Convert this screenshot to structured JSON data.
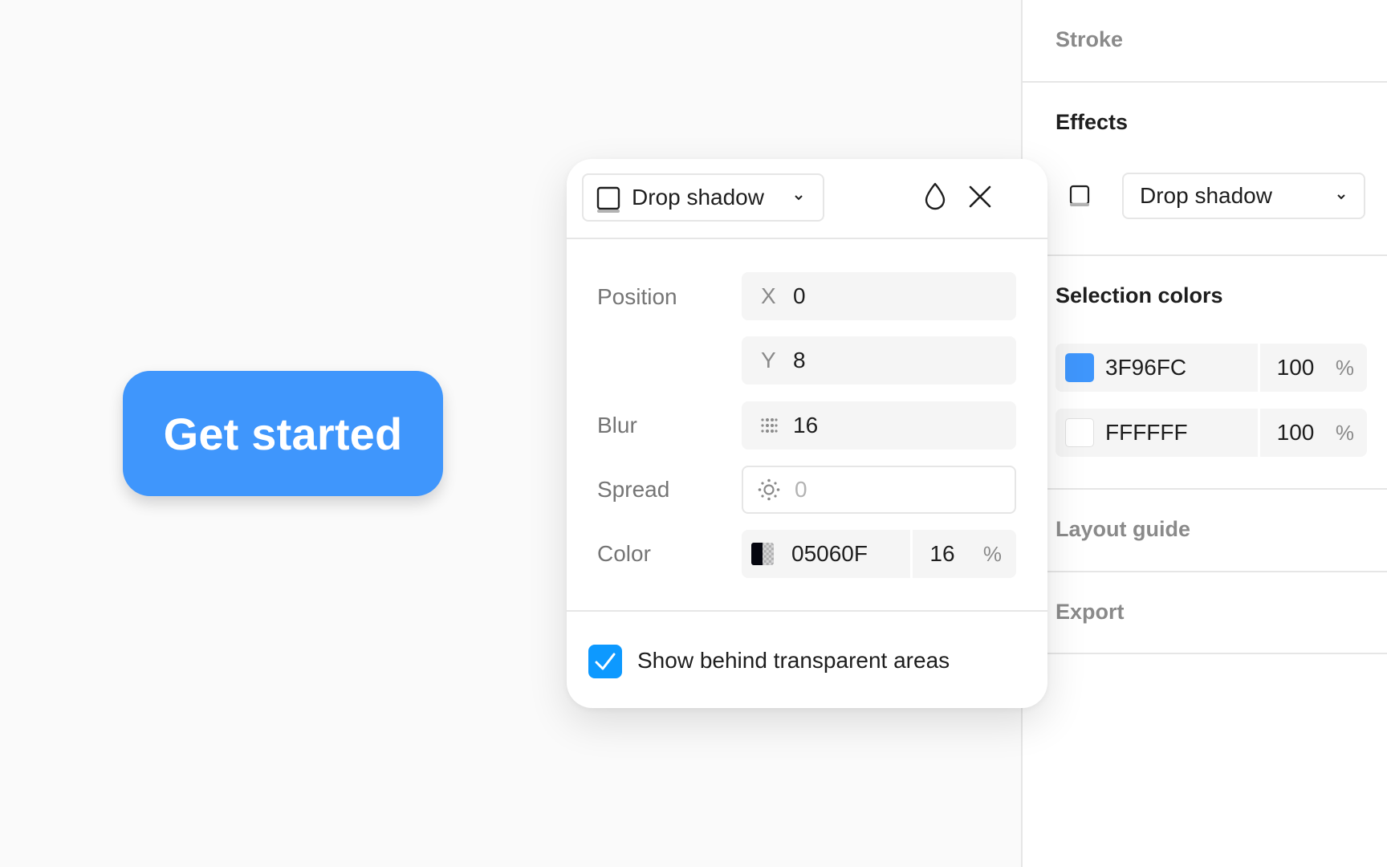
{
  "canvas": {
    "button_label": "Get started"
  },
  "panel": {
    "stroke_title": "Stroke",
    "effects_title": "Effects",
    "effect_type": "Drop shadow",
    "selection_colors_title": "Selection colors",
    "selection_colors": [
      {
        "hex": "3F96FC",
        "opacity": "100",
        "unit": "%",
        "swatch": "#3f96fc"
      },
      {
        "hex": "FFFFFF",
        "opacity": "100",
        "unit": "%",
        "swatch": "#ffffff"
      }
    ],
    "layout_guide_title": "Layout guide",
    "export_title": "Export"
  },
  "popup": {
    "effect_type": "Drop shadow",
    "position_label": "Position",
    "x_axis": "X",
    "x_value": "0",
    "y_axis": "Y",
    "y_value": "8",
    "blur_label": "Blur",
    "blur_value": "16",
    "spread_label": "Spread",
    "spread_value": "0",
    "color_label": "Color",
    "color_hex": "05060F",
    "color_opacity": "16",
    "color_unit": "%",
    "show_behind_label": "Show behind transparent areas",
    "show_behind_checked": true
  },
  "icons": {
    "drop_shadow": "drop-shadow-icon",
    "visibility_drop": "drop-icon",
    "close": "close-icon",
    "blur": "blur-icon",
    "spread": "spread-icon",
    "chevron": "chevron-down-icon",
    "check": "check-icon"
  },
  "colors": {
    "accent": "#0d99ff",
    "brand_blue": "#3f96fc"
  }
}
